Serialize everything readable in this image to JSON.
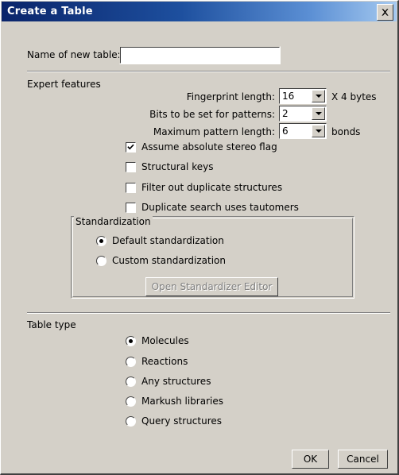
{
  "window": {
    "title": "Create a Table",
    "close_icon": "close-icon"
  },
  "form": {
    "name_label": "Name of new table:",
    "name_value": "",
    "name_placeholder": ""
  },
  "expert": {
    "section_label": "Expert features",
    "fields": [
      {
        "label": "Fingerprint length:",
        "value": "16",
        "suffix": "X 4 bytes"
      },
      {
        "label": "Bits to be set for patterns:",
        "value": "2",
        "suffix": ""
      },
      {
        "label": "Maximum pattern length:",
        "value": "6",
        "suffix": "bonds"
      }
    ],
    "checkboxes": [
      {
        "label": "Assume absolute stereo flag",
        "checked": true
      },
      {
        "label": "Structural keys",
        "checked": false
      },
      {
        "label": "Filter out duplicate structures",
        "checked": false
      },
      {
        "label": "Duplicate search uses tautomers",
        "checked": false
      }
    ]
  },
  "standardization": {
    "group_label": "Standardization",
    "options": [
      {
        "label": "Default standardization",
        "selected": true
      },
      {
        "label": "Custom standardization",
        "selected": false
      }
    ],
    "editor_button": "Open Standardizer Editor",
    "editor_button_enabled": false
  },
  "table_type": {
    "section_label": "Table type",
    "options": [
      {
        "label": "Molecules",
        "selected": true
      },
      {
        "label": "Reactions",
        "selected": false
      },
      {
        "label": "Any structures",
        "selected": false
      },
      {
        "label": "Markush libraries",
        "selected": false
      },
      {
        "label": "Query structures",
        "selected": false
      }
    ]
  },
  "footer": {
    "ok_label": "OK",
    "cancel_label": "Cancel"
  },
  "colors": {
    "dialog_bg": "#d4d0c8",
    "title_start": "#0a246a",
    "title_end": "#a6caf0",
    "field_bg": "#ffffff",
    "disabled_text": "#808080"
  }
}
